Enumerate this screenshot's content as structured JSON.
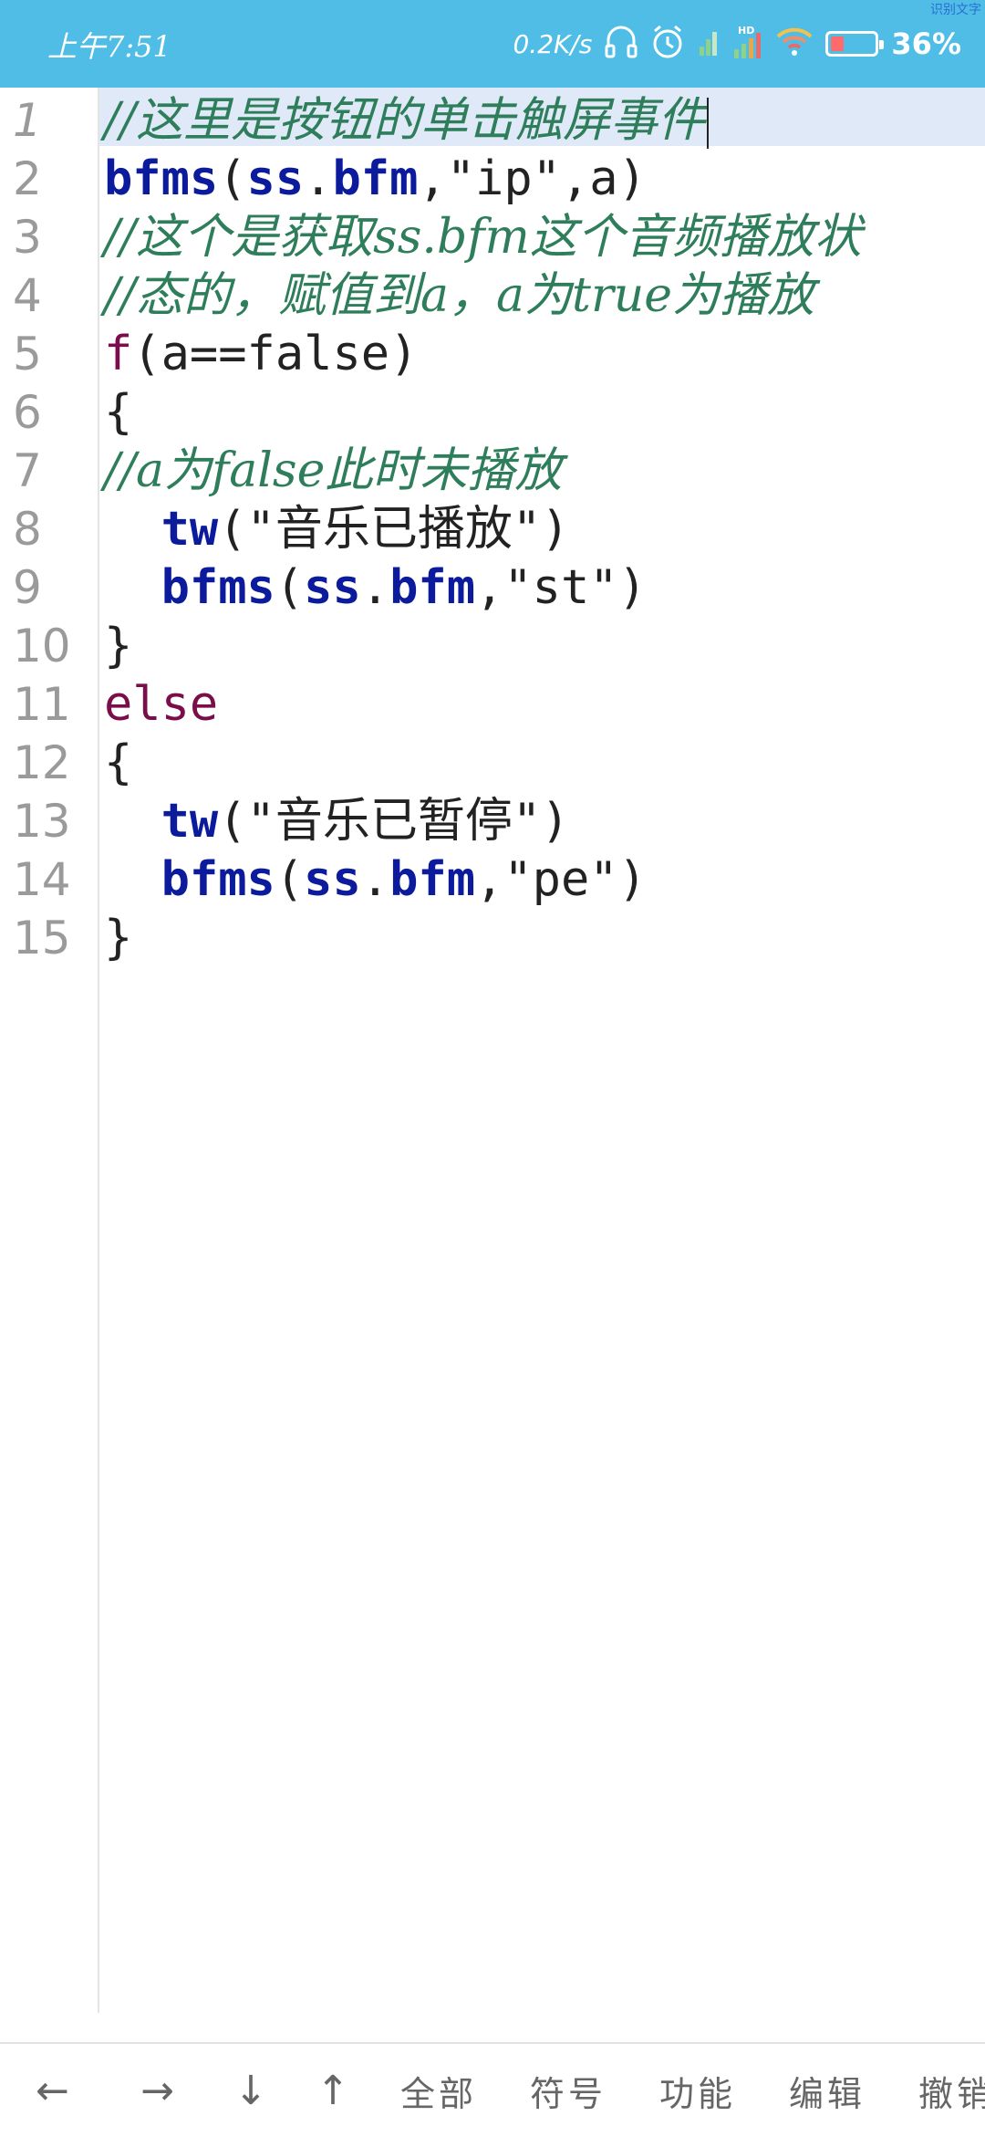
{
  "status_bar": {
    "time": "上午7:51",
    "net_speed": "0.2K/s",
    "battery_percent": "36%",
    "corner_text": "识别文字",
    "icons": [
      "headphones-icon",
      "alarm-icon",
      "signal-icon",
      "hd-signal-icon",
      "wifi-icon",
      "battery-icon"
    ]
  },
  "editor": {
    "current_line": 1,
    "lines": [
      {
        "n": "1",
        "code": "//这里是按钮的单击触屏事件"
      },
      {
        "n": "2",
        "code": "bfms(ss.bfm,\"ip\",a)"
      },
      {
        "n": "3",
        "code": "//这个是获取ss.bfm这个音频播放状"
      },
      {
        "n": "4",
        "code": "//态的，赋值到a，a为true为播放"
      },
      {
        "n": "5",
        "code": "f(a==false)"
      },
      {
        "n": "6",
        "code": "{"
      },
      {
        "n": "7",
        "code": "//a为false此时未播放"
      },
      {
        "n": "8",
        "code": "  tw(\"音乐已播放\")"
      },
      {
        "n": "9",
        "code": "  bfms(ss.bfm,\"st\")"
      },
      {
        "n": "10",
        "code": "}"
      },
      {
        "n": "11",
        "code": "else"
      },
      {
        "n": "12",
        "code": "{"
      },
      {
        "n": "13",
        "code": "  tw(\"音乐已暂停\")"
      },
      {
        "n": "14",
        "code": "  bfms(ss.bfm,\"pe\")"
      },
      {
        "n": "15",
        "code": "}"
      }
    ]
  },
  "toolbar": {
    "left": "←",
    "right": "→",
    "down": "↓",
    "up": "↑",
    "all": "全部",
    "symbols": "符号",
    "functions": "功能",
    "edit": "编辑",
    "undo": "撤销"
  }
}
